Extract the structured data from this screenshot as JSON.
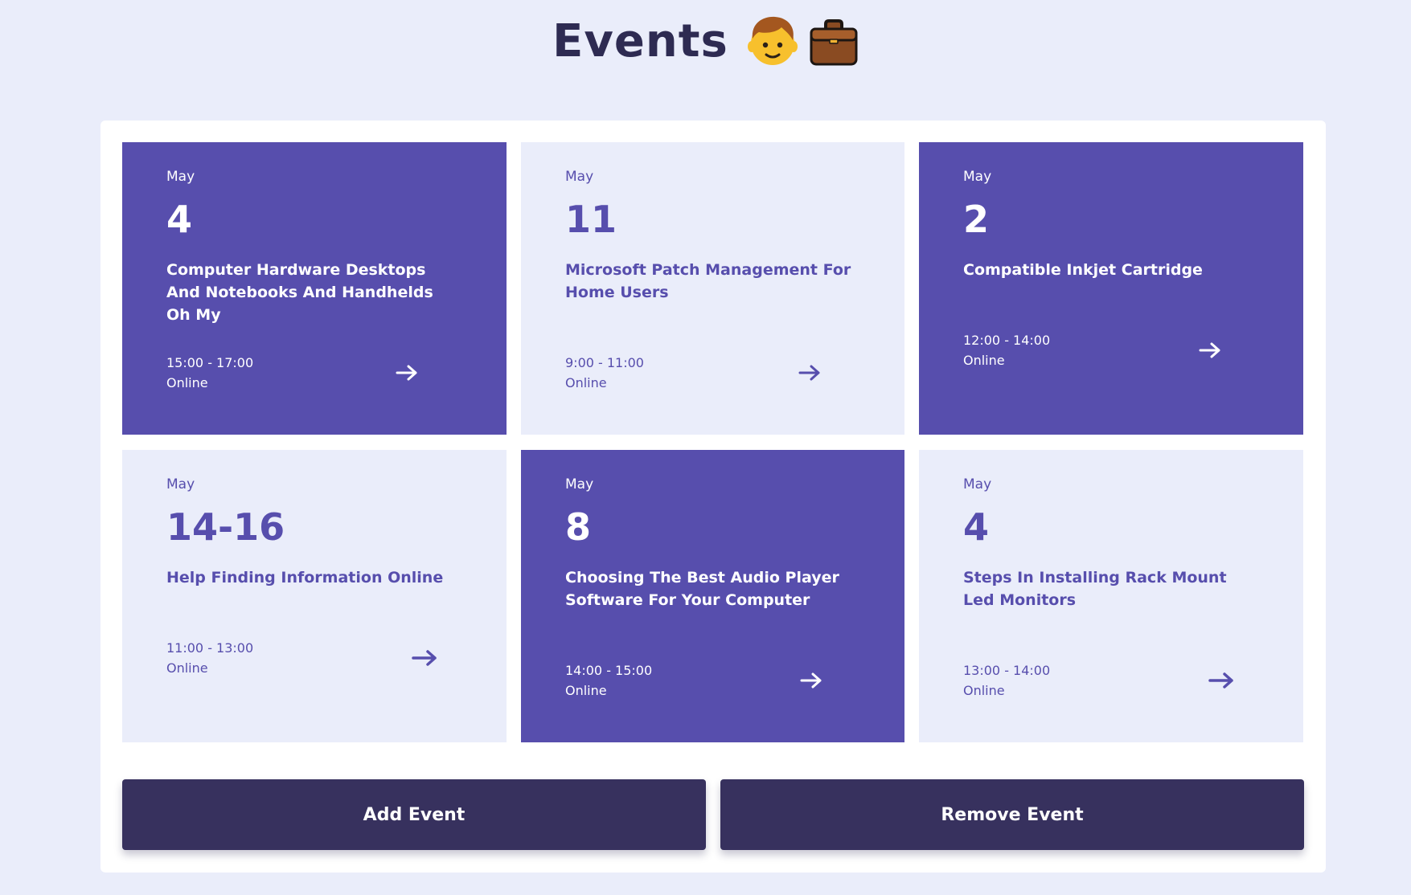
{
  "header": {
    "title": "Events",
    "icons": [
      "boy-face-icon",
      "briefcase-icon"
    ]
  },
  "colors": {
    "page_bg": "#eaedfa",
    "card_filled": "#574ead",
    "card_light": "#eaedfa",
    "button_bg": "#37315e",
    "title_text": "#2e2b52"
  },
  "events": [
    {
      "month": "May",
      "day": "4",
      "title": "Computer Hardware Desktops And Notebooks And Handhelds Oh My",
      "time": "15:00 - 17:00",
      "location": "Online",
      "style": "filled"
    },
    {
      "month": "May",
      "day": "11",
      "title": "Microsoft Patch Management For Home Users",
      "time": "9:00 - 11:00",
      "location": "Online",
      "style": "light"
    },
    {
      "month": "May",
      "day": "2",
      "title": "Compatible Inkjet Cartridge",
      "time": "12:00 - 14:00",
      "location": "Online",
      "style": "filled"
    },
    {
      "month": "May",
      "day": "14-16",
      "title": "Help Finding Information Online",
      "time": "11:00 - 13:00",
      "location": "Online",
      "style": "light"
    },
    {
      "month": "May",
      "day": "8",
      "title": "Choosing The Best Audio Player Software For Your Computer",
      "time": "14:00 - 15:00",
      "location": "Online",
      "style": "filled"
    },
    {
      "month": "May",
      "day": "4",
      "title": "Steps In Installing Rack Mount Led Monitors",
      "time": "13:00 - 14:00",
      "location": "Online",
      "style": "light"
    }
  ],
  "actions": {
    "add_label": "Add Event",
    "remove_label": "Remove Event"
  }
}
